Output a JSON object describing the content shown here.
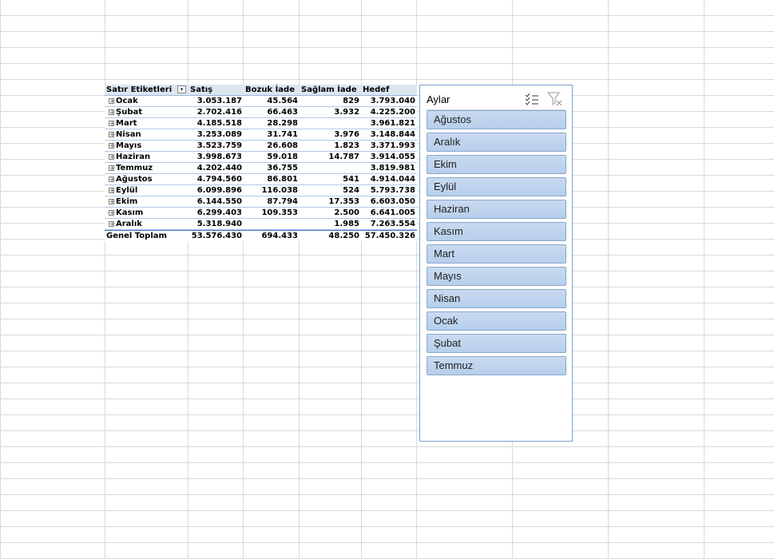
{
  "pivot": {
    "headers": [
      "Satır Etiketleri",
      "Satış",
      "Bozuk İade",
      "Sağlam İade",
      "Hedef"
    ],
    "rows": [
      {
        "label": "Ocak",
        "satis": "3.053.187",
        "bozuk": "45.564",
        "saglam": "829",
        "hedef": "3.793.040"
      },
      {
        "label": "Şubat",
        "satis": "2.702.416",
        "bozuk": "66.463",
        "saglam": "3.932",
        "hedef": "4.225.200"
      },
      {
        "label": "Mart",
        "satis": "4.185.518",
        "bozuk": "28.298",
        "saglam": "",
        "hedef": "3.961.821"
      },
      {
        "label": "Nisan",
        "satis": "3.253.089",
        "bozuk": "31.741",
        "saglam": "3.976",
        "hedef": "3.148.844"
      },
      {
        "label": "Mayıs",
        "satis": "3.523.759",
        "bozuk": "26.608",
        "saglam": "1.823",
        "hedef": "3.371.993"
      },
      {
        "label": "Haziran",
        "satis": "3.998.673",
        "bozuk": "59.018",
        "saglam": "14.787",
        "hedef": "3.914.055"
      },
      {
        "label": "Temmuz",
        "satis": "4.202.440",
        "bozuk": "36.755",
        "saglam": "",
        "hedef": "3.819.981"
      },
      {
        "label": "Ağustos",
        "satis": "4.794.560",
        "bozuk": "86.801",
        "saglam": "541",
        "hedef": "4.914.044"
      },
      {
        "label": "Eylül",
        "satis": "6.099.896",
        "bozuk": "116.038",
        "saglam": "524",
        "hedef": "5.793.738"
      },
      {
        "label": "Ekim",
        "satis": "6.144.550",
        "bozuk": "87.794",
        "saglam": "17.353",
        "hedef": "6.603.050"
      },
      {
        "label": "Kasım",
        "satis": "6.299.403",
        "bozuk": "109.353",
        "saglam": "2.500",
        "hedef": "6.641.005"
      },
      {
        "label": "Aralık",
        "satis": "5.318.940",
        "bozuk": "",
        "saglam": "1.985",
        "hedef": "7.263.554"
      }
    ],
    "total": {
      "label": "Genel Toplam",
      "satis": "53.576.430",
      "bozuk": "694.433",
      "saglam": "48.250",
      "hedef": "57.450.326"
    },
    "expand_glyph": "+",
    "filter_glyph": "▾"
  },
  "slicer": {
    "title": "Aylar",
    "multiselect_icon": "multi-select-icon",
    "clear_filter_icon": "clear-filter-icon",
    "items": [
      "Ağustos",
      "Aralık",
      "Ekim",
      "Eylül",
      "Haziran",
      "Kasım",
      "Mart",
      "Mayıs",
      "Nisan",
      "Ocak",
      "Şubat",
      "Temmuz"
    ],
    "item_color": "#bdd3ee",
    "border_color": "#7ba0cd"
  }
}
